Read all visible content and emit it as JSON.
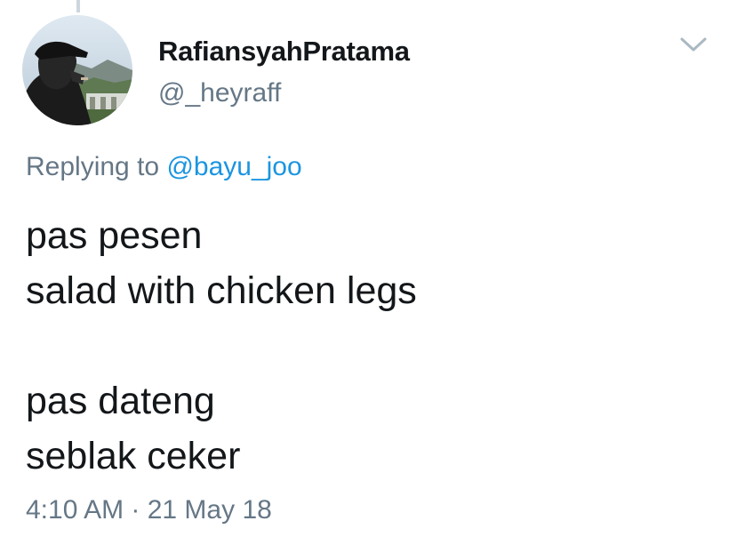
{
  "tweet": {
    "author": {
      "display_name": "RafiansyahPratama",
      "handle": "@_heyraff"
    },
    "reply": {
      "prefix": "Replying to ",
      "target": "@bayu_joo"
    },
    "text_lines": [
      "pas pesen",
      "salad with chicken legs",
      "",
      "pas dateng",
      "seblak ceker"
    ],
    "timestamp": "4:10 AM · 21 May 18"
  },
  "icons": {
    "menu": "chevron-down-icon"
  },
  "colors": {
    "text_primary": "#14171a",
    "text_secondary": "#657786",
    "link": "#1b95e0",
    "chevron": "#aab8c2",
    "thread_line": "#ccd6dd"
  }
}
